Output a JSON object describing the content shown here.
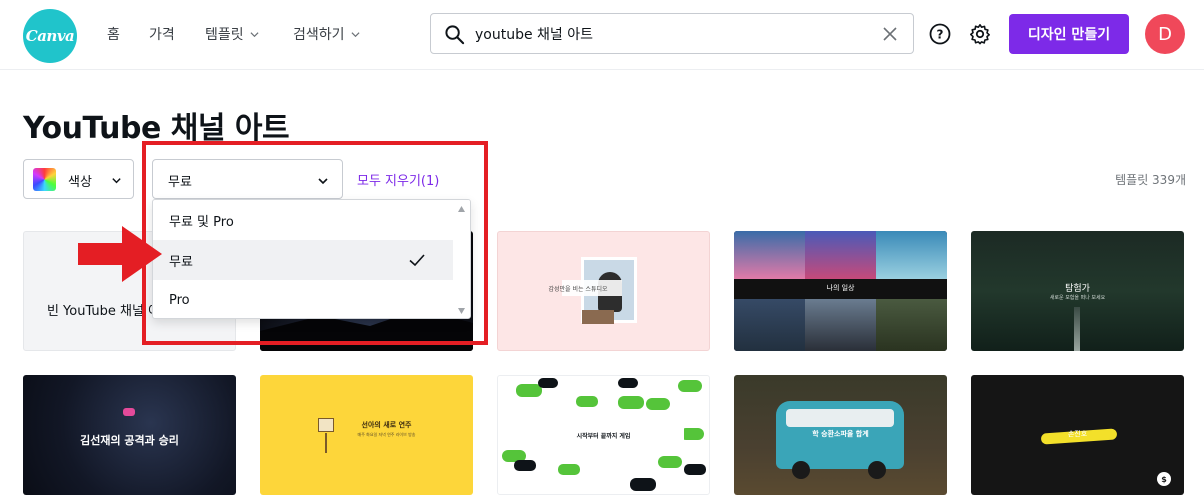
{
  "header": {
    "logo_text": "Canva",
    "nav": [
      "홈",
      "가격",
      "템플릿",
      "검색하기"
    ],
    "search_value": "youtube 채널 아트",
    "create_button": "디자인 만들기",
    "avatar_letter": "D",
    "accent_color": "#7d2ae8",
    "logo_color": "#20c4cb",
    "avatar_color": "#f0485a"
  },
  "page": {
    "title": "YouTube 채널 아트",
    "color_filter_label": "색상",
    "price_selected": "무료",
    "clear_all": "모두 지우기(1)",
    "template_count": "템플릿 339개"
  },
  "dropdown": {
    "options": [
      "무료 및 Pro",
      "무료",
      "Pro"
    ],
    "selected_index": 1
  },
  "cards": {
    "blank_label": "빈 YouTube 채널 아트 만들기",
    "card3_text": "감성만을 비는 스튜디오",
    "card4_text": "나의 일상",
    "card5_text": "탐험가",
    "card5_sub": "새로운 모험을 떠나 보세요",
    "card6_text": "김선재의 공격과 승리",
    "card7_text": "선아의 새로 연주",
    "card7_sub": "매주 화요일 저녁 연주 라이브 방송",
    "card8_text": "시작부터 끝까지 게임",
    "card9_text": "학 승환소파올 합계",
    "card10_text": "손진호"
  }
}
